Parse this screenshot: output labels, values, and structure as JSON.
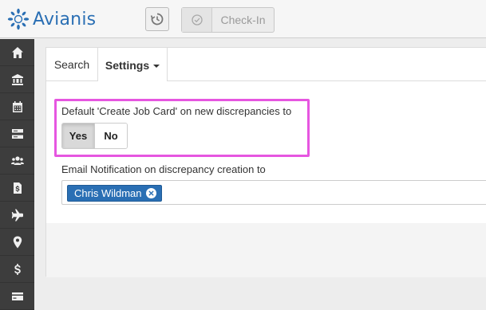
{
  "app": {
    "brand": "Avianis",
    "colors": {
      "brand_blue": "#2a6fb4",
      "highlight": "#e656e0",
      "sidebar_bg": "#3d3d3d"
    }
  },
  "toolbar": {
    "history_icon": "history-icon",
    "checkin_icon": "check-circle-icon",
    "checkin_label": "Check-In"
  },
  "sidebar": {
    "items": [
      {
        "icon": "home-icon"
      },
      {
        "icon": "bank-icon"
      },
      {
        "icon": "calendar-icon"
      },
      {
        "icon": "server-icon"
      },
      {
        "icon": "users-icon"
      },
      {
        "icon": "invoice-icon"
      },
      {
        "icon": "plane-icon"
      },
      {
        "icon": "map-marker-icon"
      },
      {
        "icon": "dollar-icon"
      },
      {
        "icon": "card-icon"
      }
    ]
  },
  "tabs": {
    "search_label": "Search",
    "settings_label": "Settings"
  },
  "settings": {
    "create_job_card_label": "Default 'Create Job Card' on new discrepancies to",
    "yes_label": "Yes",
    "no_label": "No",
    "selected": "Yes",
    "email_label": "Email Notification on discrepancy creation to",
    "recipients": [
      "Chris Wildman"
    ]
  }
}
